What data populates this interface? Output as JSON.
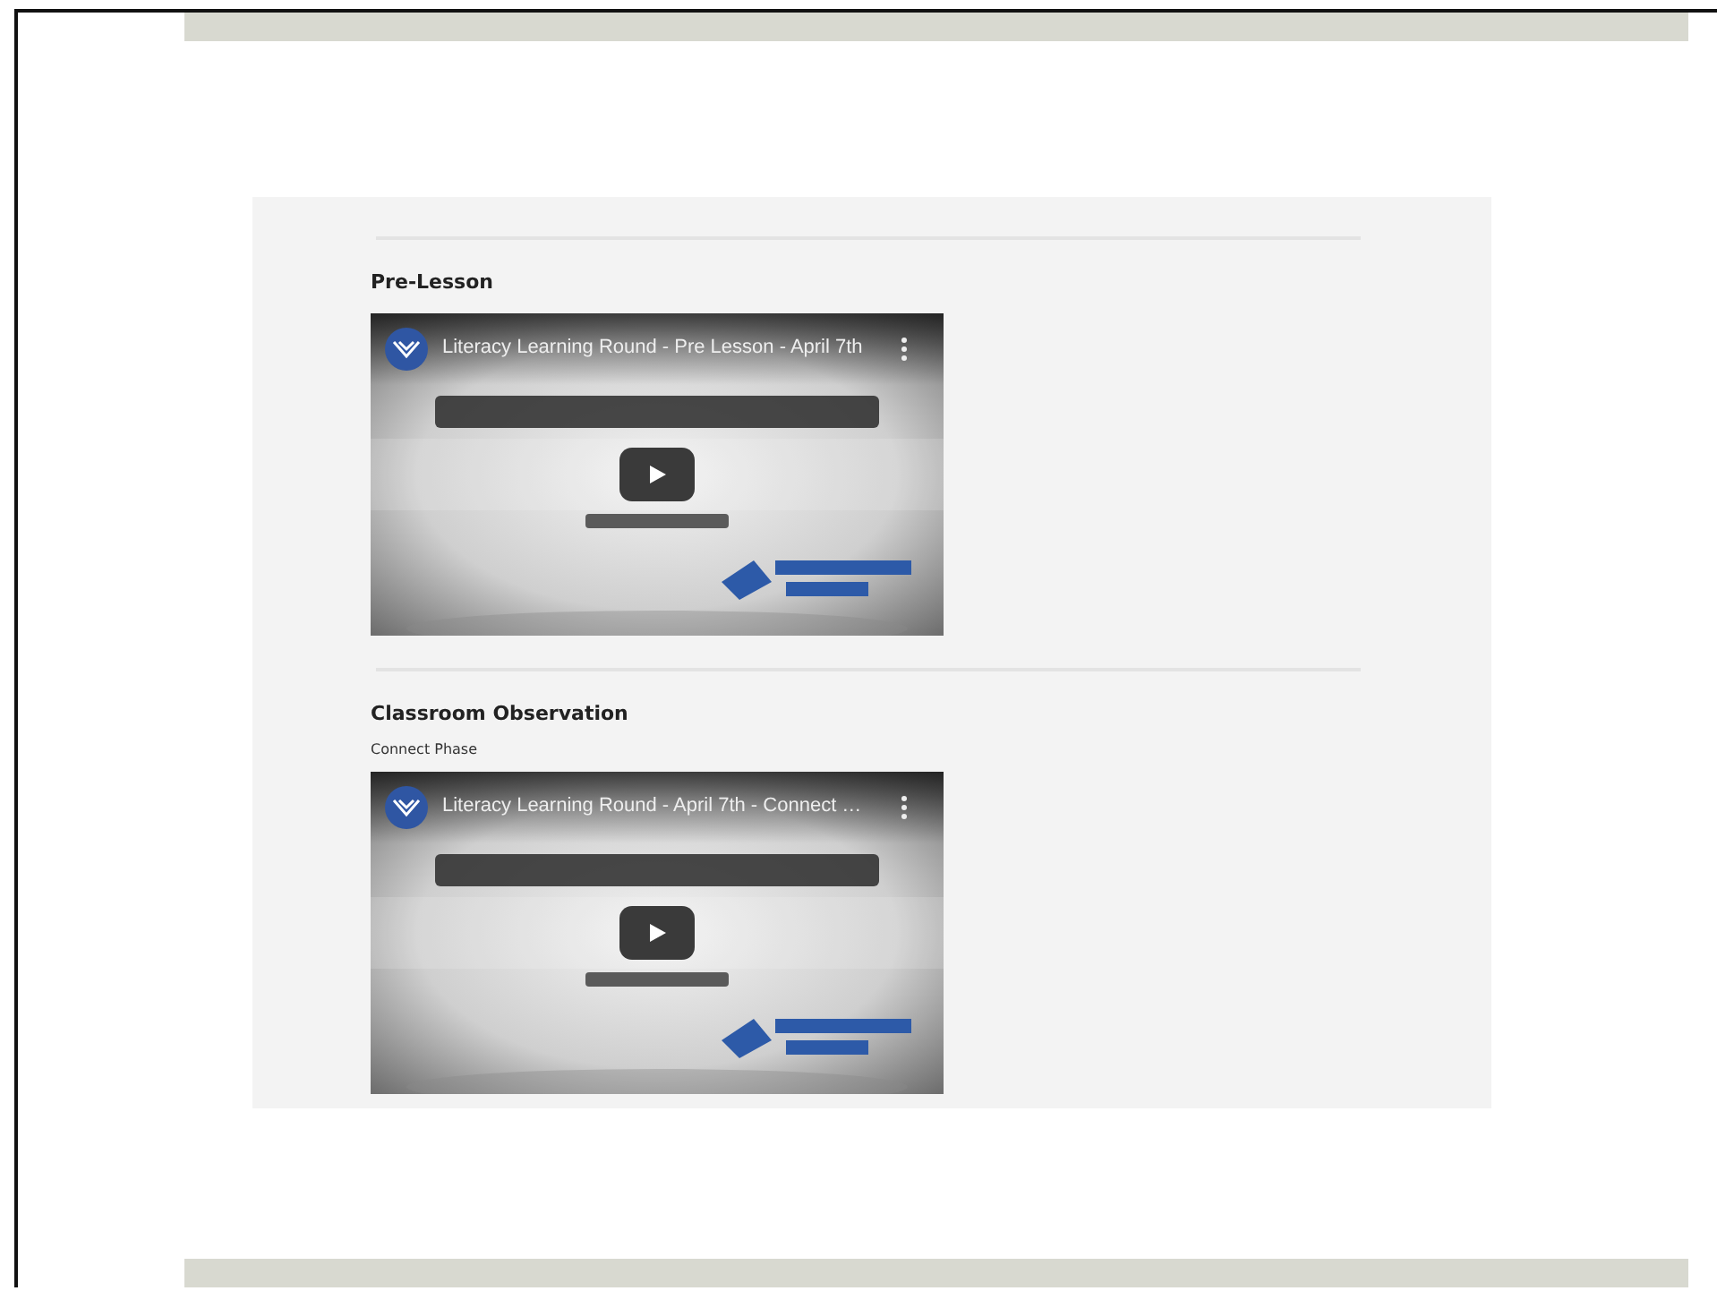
{
  "sections": [
    {
      "heading": "Pre-Lesson",
      "video": {
        "title": "Literacy Learning Round - Pre Lesson - April 7th"
      }
    },
    {
      "heading": "Classroom Observation",
      "subheading": "Connect Phase",
      "video": {
        "title": "Literacy Learning Round - April 7th - Connect …"
      }
    }
  ]
}
